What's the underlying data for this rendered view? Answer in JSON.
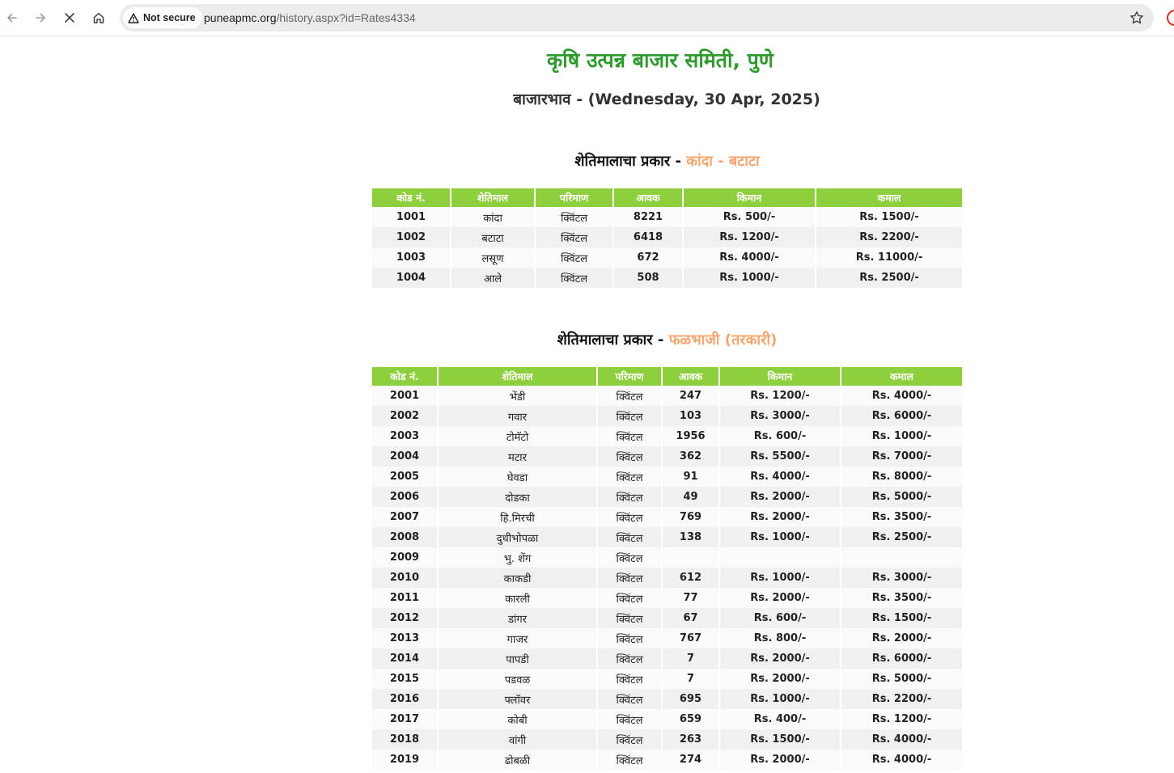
{
  "browser": {
    "security_label": "Not secure",
    "url_domain": "puneapmc.org",
    "url_path": "/history.aspx?id=Rates4334"
  },
  "page": {
    "title": "कृषि उत्पन्न बाजार समिती, पुणे",
    "date_line": "बाजारभाव - (Wednesday, 30 Apr, 2025)"
  },
  "sections": [
    {
      "heading_prefix": "शेतिमालाचा प्रकार",
      "heading_dash": " - ",
      "heading_category": "कांदा - बटाटा",
      "columns": [
        "कोड नं.",
        "शेतिमाल",
        "परिमाण",
        "आवक",
        "किमान",
        "कमाल"
      ],
      "rows": [
        [
          "1001",
          "कांदा",
          "क्विंटल",
          "8221",
          "Rs. 500/-",
          "Rs. 1500/-"
        ],
        [
          "1002",
          "बटाटा",
          "क्विंटल",
          "6418",
          "Rs. 1200/-",
          "Rs. 2200/-"
        ],
        [
          "1003",
          "लसूण",
          "क्विंटल",
          "672",
          "Rs. 4000/-",
          "Rs. 11000/-"
        ],
        [
          "1004",
          "आले",
          "क्विंटल",
          "508",
          "Rs. 1000/-",
          "Rs. 2500/-"
        ]
      ]
    },
    {
      "heading_prefix": "शेतिमालाचा प्रकार",
      "heading_dash": " - ",
      "heading_category": "फळभाजी (तरकारी)",
      "columns": [
        "कोड नं.",
        "शेतिमाल",
        "परिमाण",
        "आवक",
        "किमान",
        "कमाल"
      ],
      "rows": [
        [
          "2001",
          "भेंडी",
          "क्विंटल",
          "247",
          "Rs. 1200/-",
          "Rs. 4000/-"
        ],
        [
          "2002",
          "गवार",
          "क्विंटल",
          "103",
          "Rs. 3000/-",
          "Rs. 6000/-"
        ],
        [
          "2003",
          "टोमॅटो",
          "क्विंटल",
          "1956",
          "Rs. 600/-",
          "Rs. 1000/-"
        ],
        [
          "2004",
          "मटार",
          "क्विंटल",
          "362",
          "Rs. 5500/-",
          "Rs. 7000/-"
        ],
        [
          "2005",
          "घेवडा",
          "क्विंटल",
          "91",
          "Rs. 4000/-",
          "Rs. 8000/-"
        ],
        [
          "2006",
          "दोडका",
          "क्विंटल",
          "49",
          "Rs. 2000/-",
          "Rs. 5000/-"
        ],
        [
          "2007",
          "हि.मिरची",
          "क्विंटल",
          "769",
          "Rs. 2000/-",
          "Rs. 3500/-"
        ],
        [
          "2008",
          "दुधीभोपळा",
          "क्विंटल",
          "138",
          "Rs. 1000/-",
          "Rs. 2500/-"
        ],
        [
          "2009",
          "भु. शेंग",
          "क्विंटल",
          "",
          "",
          ""
        ],
        [
          "2010",
          "काकडी",
          "क्विंटल",
          "612",
          "Rs. 1000/-",
          "Rs. 3000/-"
        ],
        [
          "2011",
          "कारली",
          "क्विंटल",
          "77",
          "Rs. 2000/-",
          "Rs. 3500/-"
        ],
        [
          "2012",
          "डांगर",
          "क्विंटल",
          "67",
          "Rs. 600/-",
          "Rs. 1500/-"
        ],
        [
          "2013",
          "गाजर",
          "क्विंटल",
          "767",
          "Rs. 800/-",
          "Rs. 2000/-"
        ],
        [
          "2014",
          "पापडी",
          "क्विंटल",
          "7",
          "Rs. 2000/-",
          "Rs. 6000/-"
        ],
        [
          "2015",
          "पडवळ",
          "क्विंटल",
          "7",
          "Rs. 2000/-",
          "Rs. 5000/-"
        ],
        [
          "2016",
          "फ्लॉवर",
          "क्विंटल",
          "695",
          "Rs. 1000/-",
          "Rs. 2200/-"
        ],
        [
          "2017",
          "कोबी",
          "क्विंटल",
          "659",
          "Rs. 400/-",
          "Rs. 1200/-"
        ],
        [
          "2018",
          "वांगी",
          "क्विंटल",
          "263",
          "Rs. 1500/-",
          "Rs. 4000/-"
        ],
        [
          "2019",
          "ढोबळी",
          "क्विंटल",
          "274",
          "Rs. 2000/-",
          "Rs. 4000/-"
        ]
      ]
    }
  ]
}
